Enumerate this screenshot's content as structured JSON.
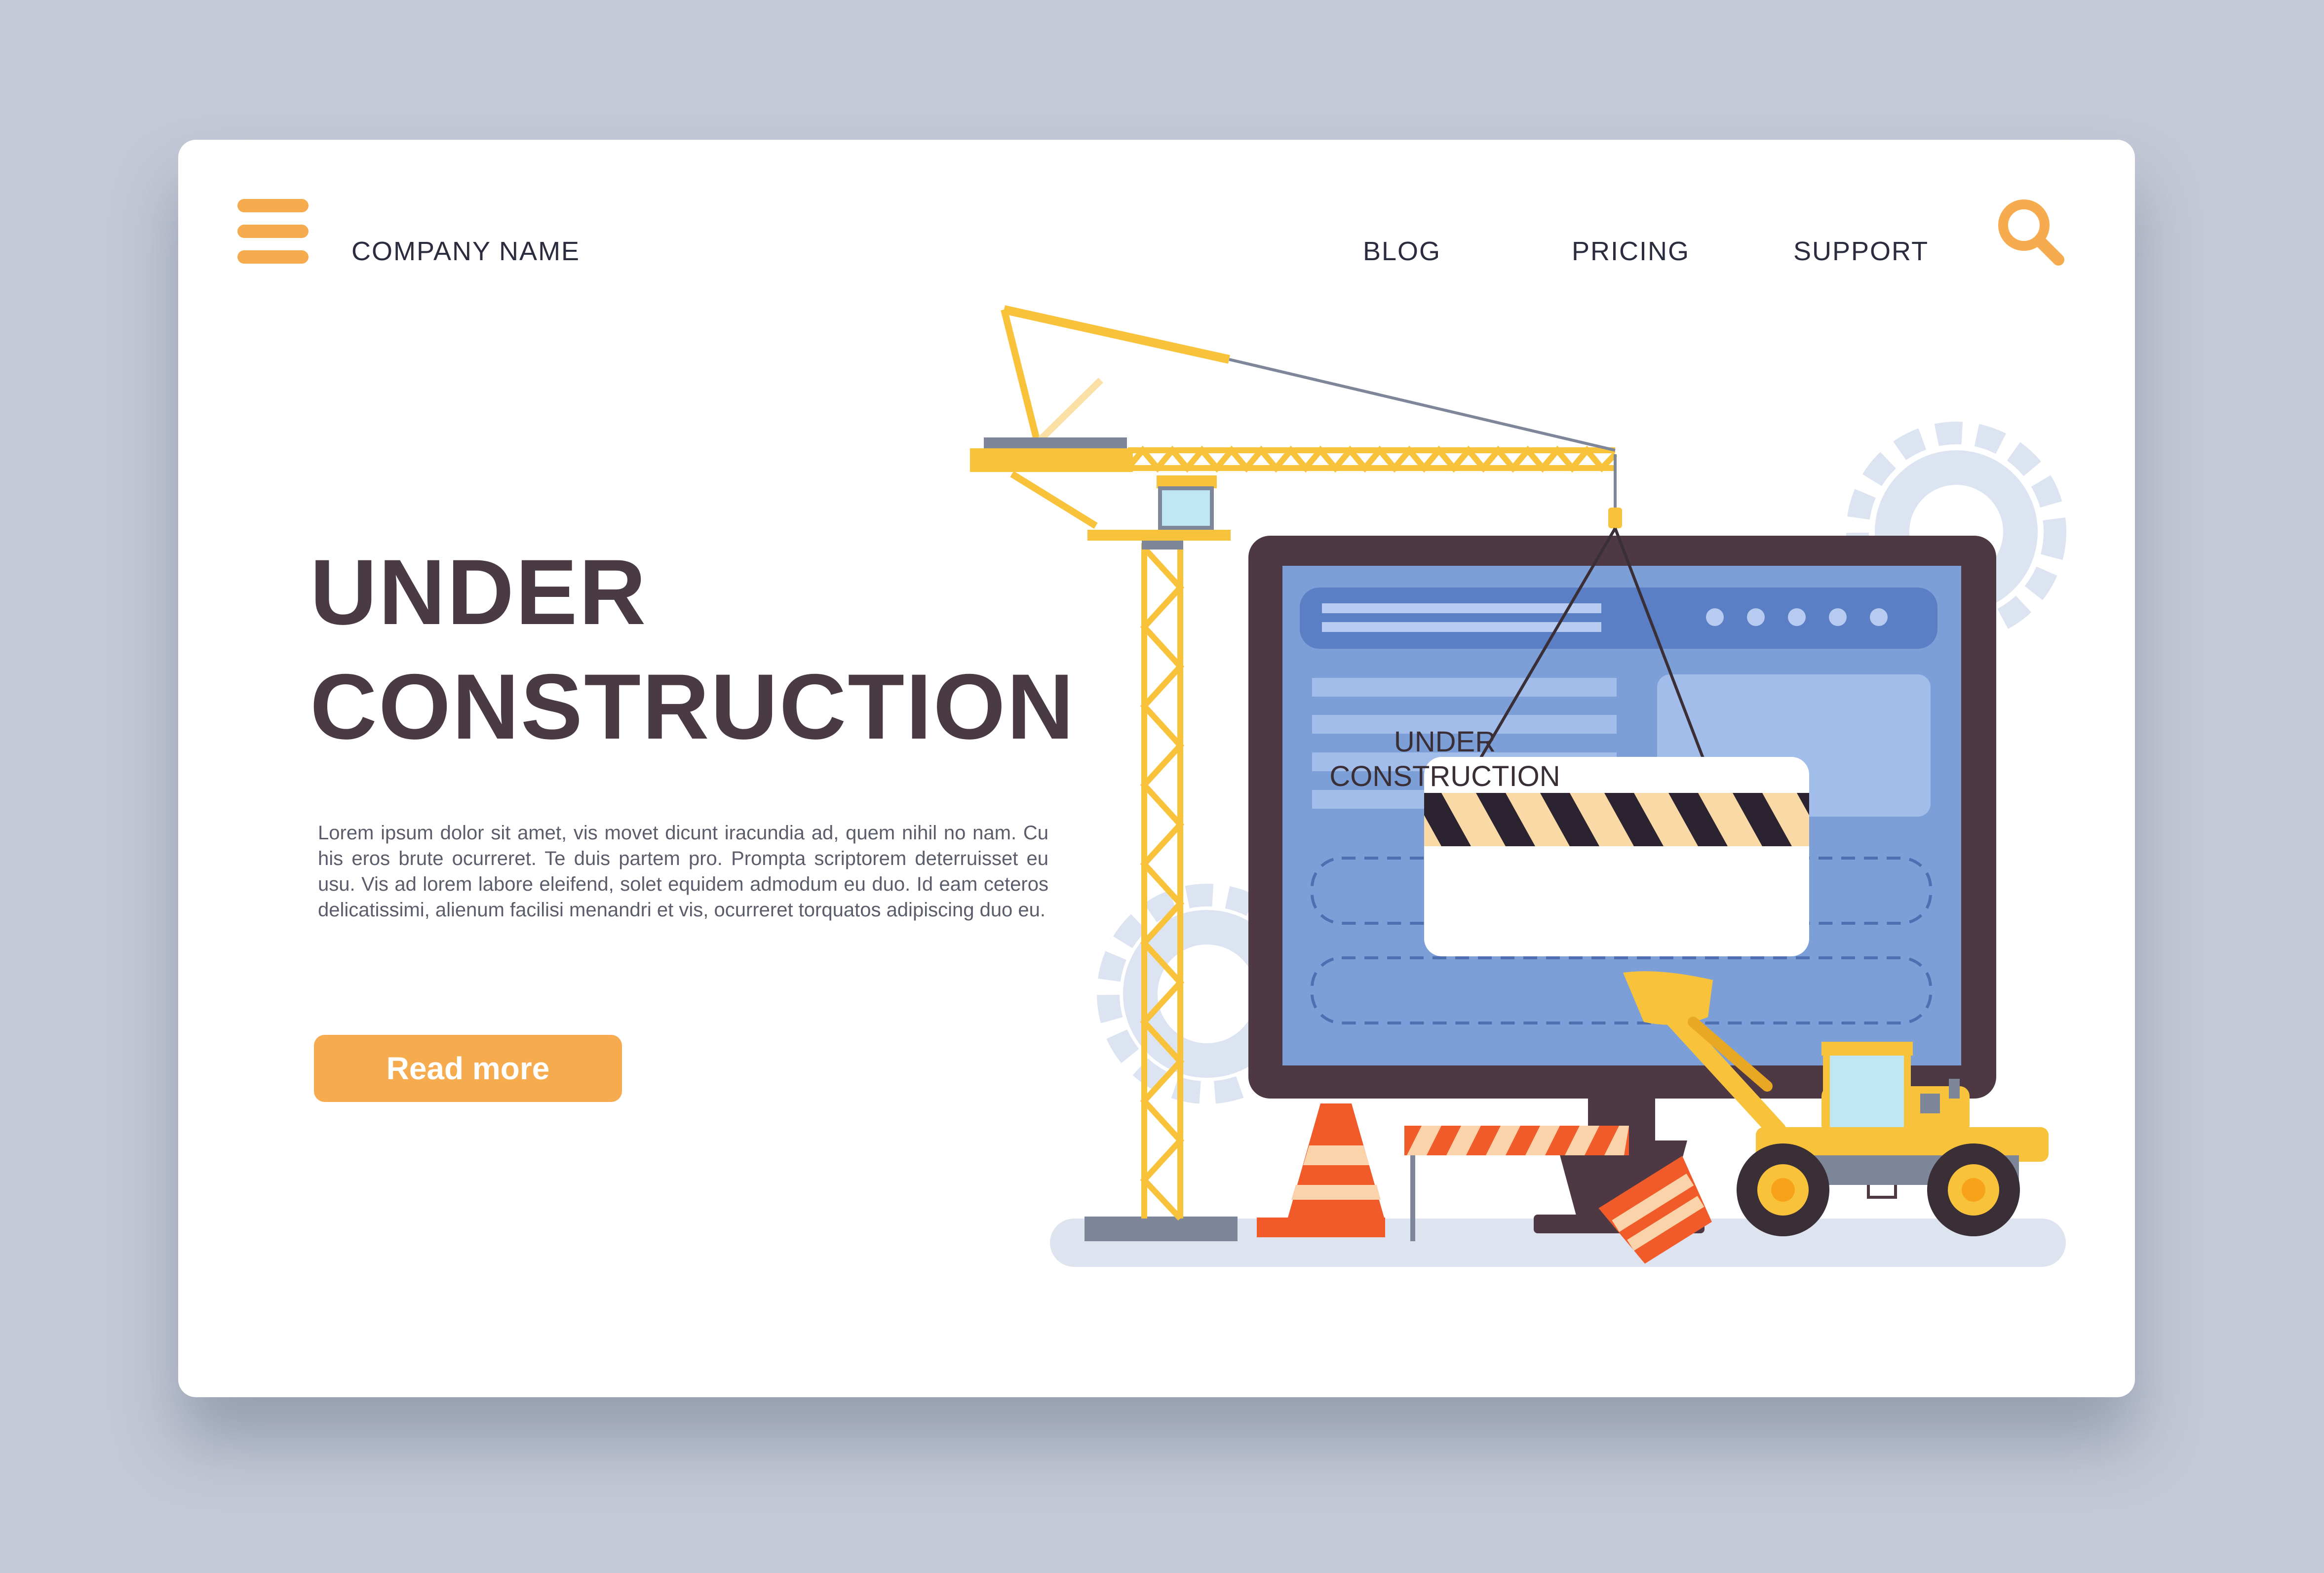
{
  "header": {
    "company_name": "COMPANY NAME",
    "nav": [
      "BLOG",
      "PRICING",
      "SUPPORT"
    ]
  },
  "icons": {
    "menu": "hamburger-menu-icon",
    "search": "magnifier-icon"
  },
  "hero": {
    "title_line1": "UNDER",
    "title_line2": "CONSTRUCTION",
    "body": "Lorem ipsum dolor sit amet, vis movet dicunt iracundia ad, quem nihil no nam. Cu his eros brute ocurreret. Te duis partem pro. Prompta scriptorem deterruisset eu usu. Vis ad lorem labore eleifend, solet equidem admodum eu duo. Id eam ceteros delicatissimi, alienum facilisi menandri et vis, ocurreret torquatos adipiscing duo eu.",
    "cta_label": "Read more"
  },
  "illustration": {
    "sign_line1": "UNDER",
    "sign_line2": "CONSTRUCTION"
  },
  "colors": {
    "background": "#c3c9d6",
    "card": "#ffffff",
    "accent": "#f7ab4f",
    "title": "#4a3a44",
    "text": "#2b2c3e",
    "monitor_frame": "#4d3843",
    "screen": "#7d9fd8",
    "crane": "#f8c33b",
    "cone": "#f15a29"
  }
}
